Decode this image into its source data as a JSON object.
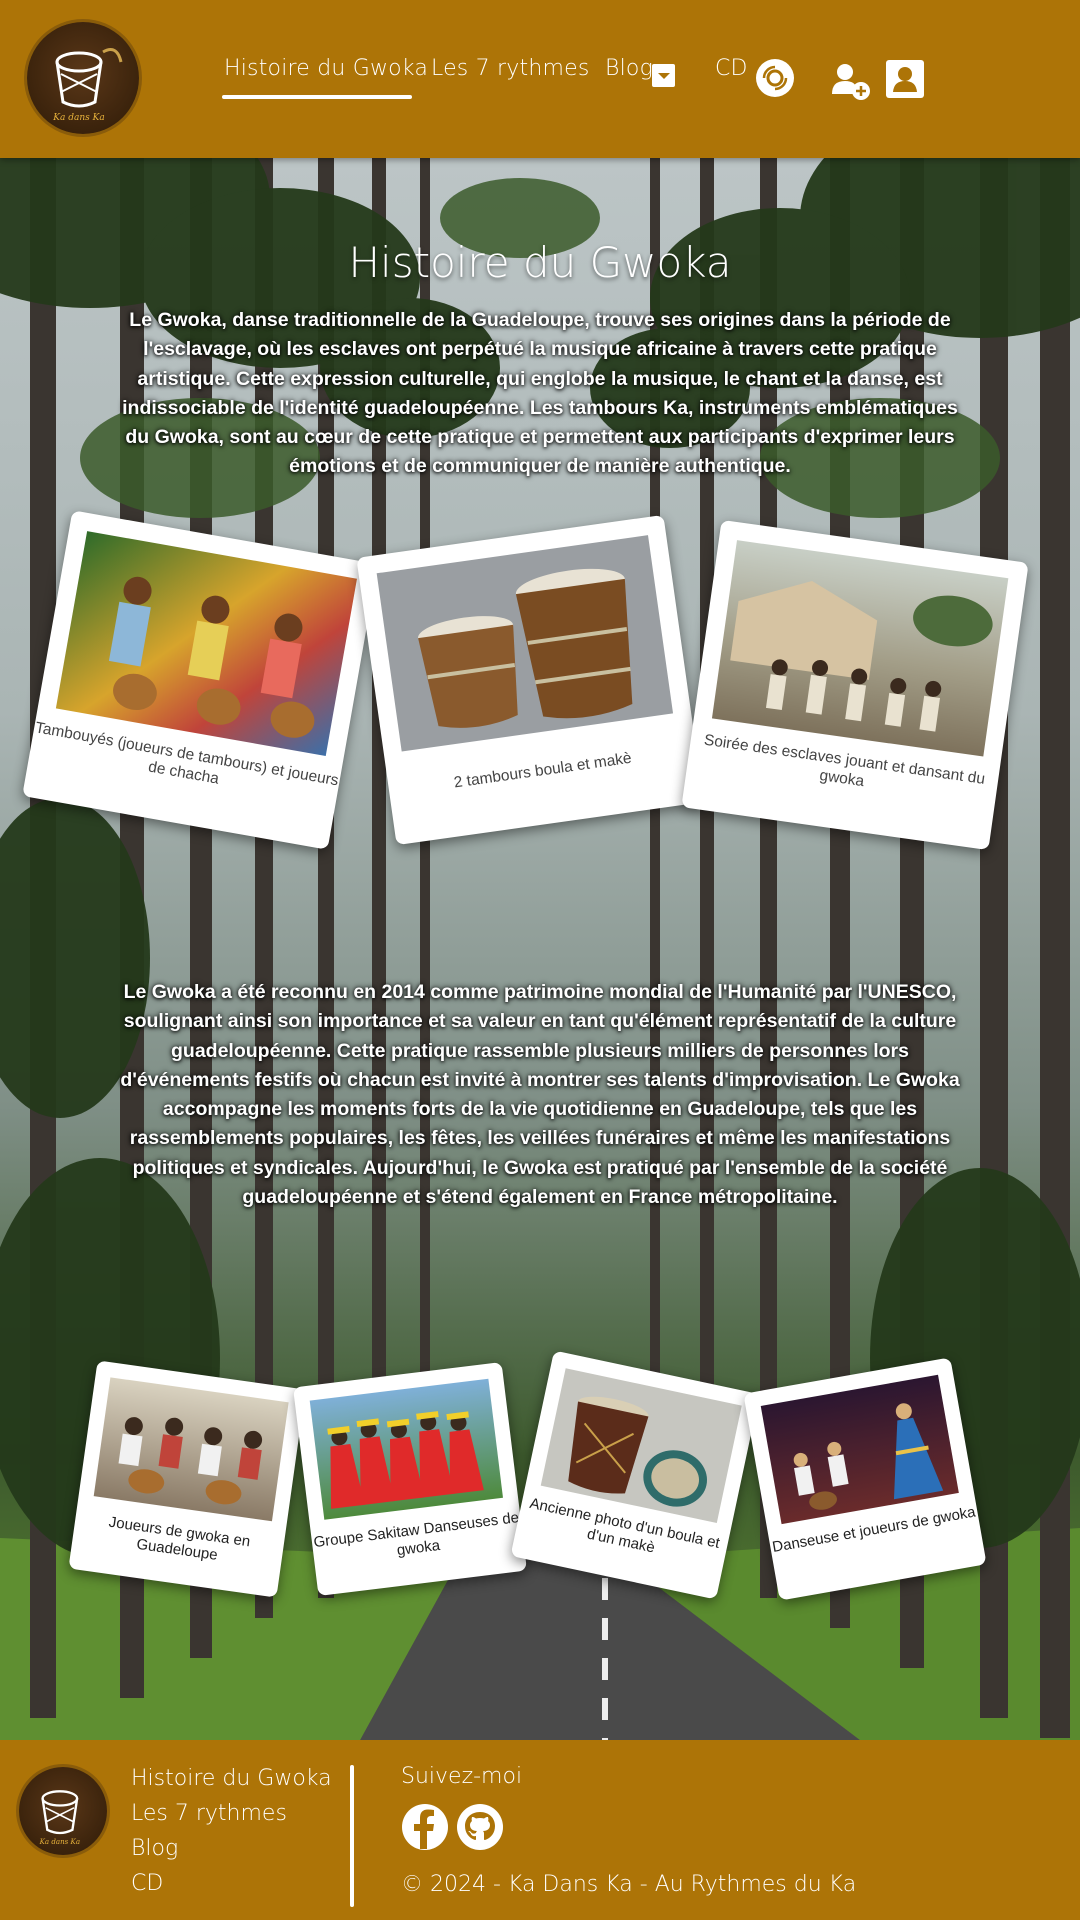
{
  "header": {
    "nav": [
      {
        "label": "Histoire du Gwoka",
        "active": true
      },
      {
        "label": "Les 7 rythmes"
      },
      {
        "label": "Blog"
      },
      {
        "label": "CD"
      }
    ],
    "icons": [
      "logo",
      "chevron-down-icon",
      "cd-disc-icon",
      "user-plus-icon",
      "user-icon"
    ]
  },
  "main": {
    "title": "Histoire du Gwoka",
    "intro": "Le Gwoka, danse traditionnelle de la Guadeloupe, trouve ses origines dans la période de l'esclavage, où les esclaves ont perpétué la musique africaine à travers cette pratique artistique. Cette expression culturelle, qui englobe la musique, le chant et la danse, est indissociable de l'identité guadeloupéenne. Les tambours Ka, instruments emblématiques du Gwoka, sont au cœur de cette pratique et permettent aux participants d'exprimer leurs émotions et de communiquer de manière authentique.",
    "gallery_top": [
      {
        "caption": "Tambouyés (joueurs de tambours) et joueurs de chacha"
      },
      {
        "caption": "2 tambours boula et makè"
      },
      {
        "caption": "Soirée des esclaves jouant et dansant du gwoka"
      }
    ],
    "second": "Le Gwoka a été reconnu en 2014 comme patrimoine mondial de l'Humanité par l'UNESCO, soulignant ainsi son importance et sa valeur en tant qu'élément représentatif de la culture guadeloupéenne. Cette pratique rassemble plusieurs milliers de personnes lors d'événements festifs où chacun est invité à montrer ses talents d'improvisation. Le Gwoka accompagne les moments forts de la vie quotidienne en Guadeloupe, tels que les rassemblements populaires, les fêtes, les veillées funéraires et même les manifestations politiques et syndicales. Aujourd'hui, le Gwoka est pratiqué par l'ensemble de la société guadeloupéenne et s'étend également en France métropolitaine.",
    "gallery_bottom": [
      {
        "caption": "Joueurs de gwoka en Guadeloupe"
      },
      {
        "caption": "Groupe Sakitaw Danseuses de gwoka"
      },
      {
        "caption": "Ancienne photo d'un boula et d'un makè"
      },
      {
        "caption": "Danseuse et joueurs de gwoka"
      }
    ]
  },
  "footer": {
    "links": [
      "Histoire du Gwoka",
      "Les 7 rythmes",
      "Blog",
      "CD"
    ],
    "follow_label": "Suivez-moi",
    "social_icons": [
      "facebook-icon",
      "github-icon"
    ],
    "copyright": "© 2024 - Ka Dans Ka - Au Rythmes du Ka"
  },
  "colors": {
    "header_bg": "#ad7407",
    "text": "#ffffff"
  }
}
